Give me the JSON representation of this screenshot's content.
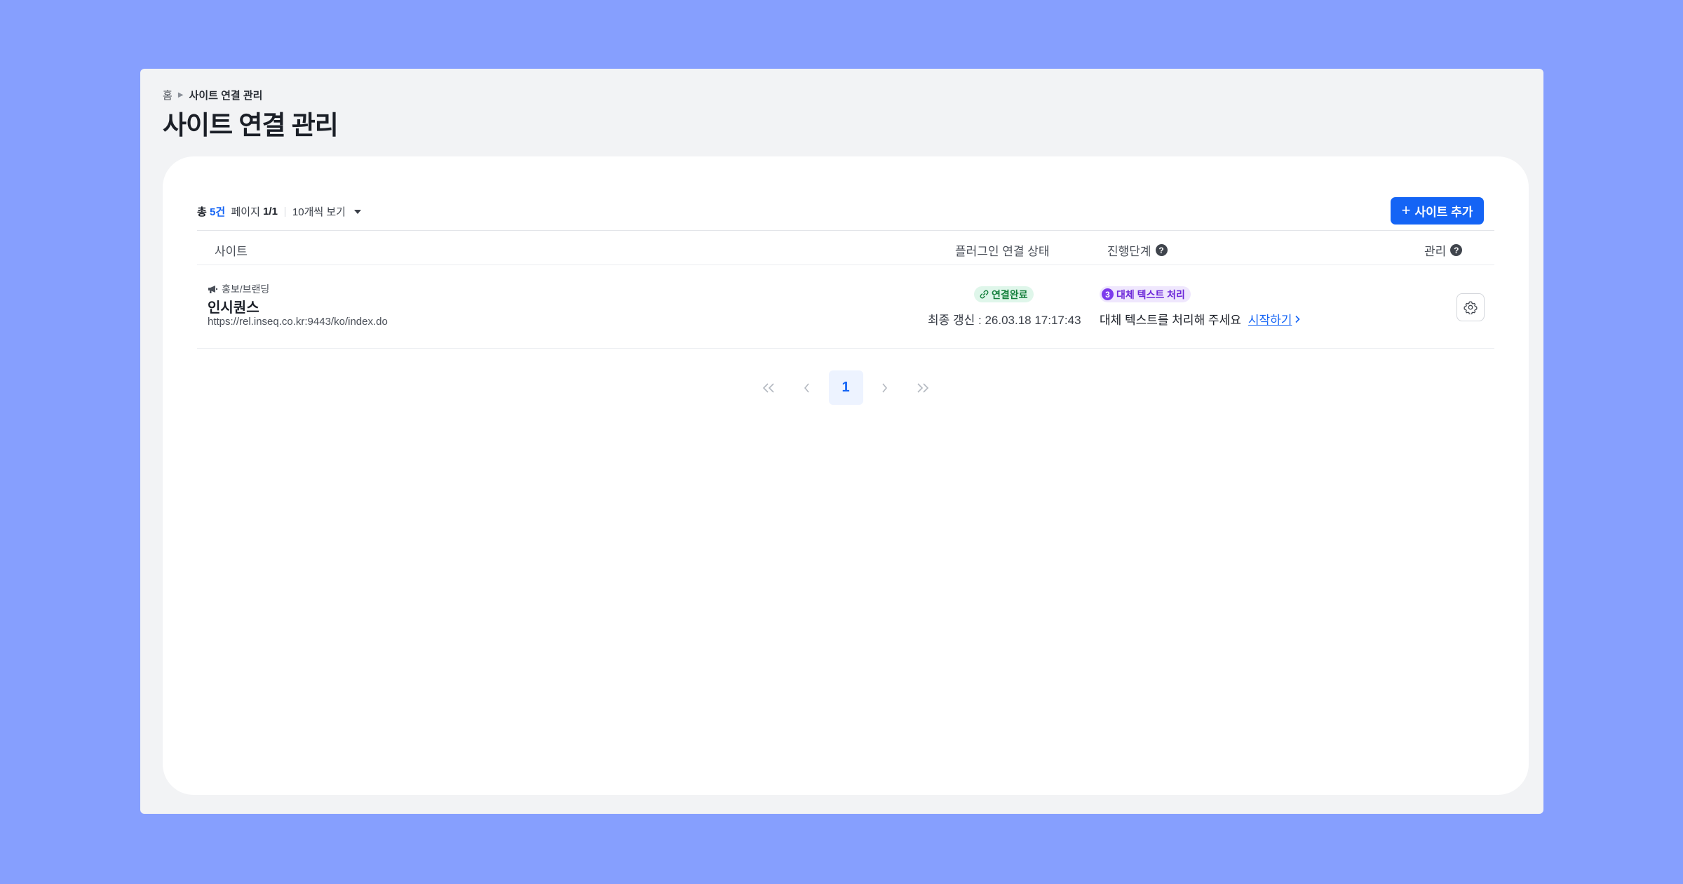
{
  "breadcrumb": {
    "home": "홈",
    "current": "사이트 연결 관리"
  },
  "page_title": "사이트 연결 관리",
  "toolbar": {
    "total_prefix": "총",
    "total_count": "5건",
    "page_label": "페이지",
    "page_value": "1/1",
    "per_page": "10개씩 보기",
    "add_button": "사이트 추가"
  },
  "table": {
    "headers": {
      "site": "사이트",
      "plugin_status": "플러그인 연결 상태",
      "stage": "진행단계",
      "manage": "관리"
    },
    "rows": [
      {
        "category": "홍보/브랜딩",
        "name": "인시퀀스",
        "url": "https://rel.inseq.co.kr:9443/ko/index.do",
        "plugin_badge": "연결완료",
        "updated": "최종 갱신 : 26.03.18 17:17:43",
        "stage_number": "3",
        "stage_badge": "대체 텍스트 처리",
        "stage_message": "대체 텍스트를 처리해 주세요",
        "stage_link": "시작하기"
      }
    ]
  },
  "pagination": {
    "current_page": "1"
  },
  "colors": {
    "background": "#869ffe",
    "accent": "#1464f5",
    "success_bg": "#dff6ea",
    "stage_purple": "#7c3aed"
  }
}
